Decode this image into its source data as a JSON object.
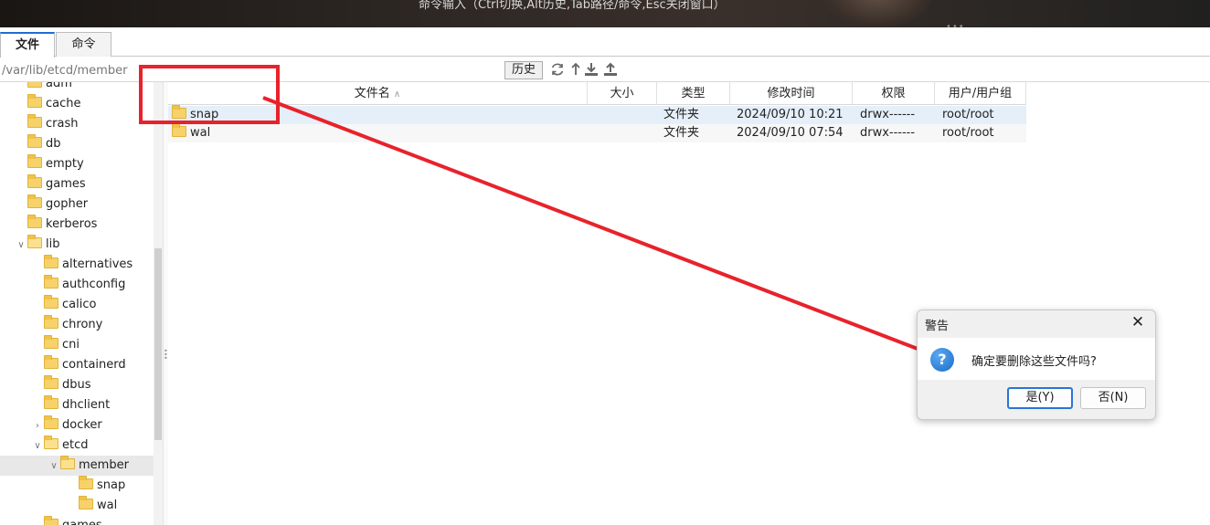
{
  "topbar": {
    "hint": "命令输入（Ctrl切换,Alt历史,Tab路径/命令,Esc关闭窗口）"
  },
  "tabs": [
    {
      "label": "文件"
    },
    {
      "label": "命令"
    }
  ],
  "pathbar": {
    "path": "/var/lib/etcd/member",
    "history_label": "历史"
  },
  "tree": {
    "items": [
      {
        "label": "adm"
      },
      {
        "label": "cache"
      },
      {
        "label": "crash"
      },
      {
        "label": "db"
      },
      {
        "label": "empty"
      },
      {
        "label": "games"
      },
      {
        "label": "gopher"
      },
      {
        "label": "kerberos"
      },
      {
        "label": "lib"
      },
      {
        "label": "alternatives"
      },
      {
        "label": "authconfig"
      },
      {
        "label": "calico"
      },
      {
        "label": "chrony"
      },
      {
        "label": "cni"
      },
      {
        "label": "containerd"
      },
      {
        "label": "dbus"
      },
      {
        "label": "dhclient"
      },
      {
        "label": "docker"
      },
      {
        "label": "etcd"
      },
      {
        "label": "member"
      },
      {
        "label": "snap"
      },
      {
        "label": "wal"
      },
      {
        "label": "games"
      }
    ]
  },
  "table": {
    "headers": [
      "文件名",
      "大小",
      "类型",
      "修改时间",
      "权限",
      "用户/用户组"
    ],
    "sort_glyph": "∧",
    "rows": [
      {
        "name": "snap",
        "size": "",
        "type": "文件夹",
        "modified": "2024/09/10 10:21",
        "perm": "drwx------",
        "owner": "root/root"
      },
      {
        "name": "wal",
        "size": "",
        "type": "文件夹",
        "modified": "2024/09/10 07:54",
        "perm": "drwx------",
        "owner": "root/root"
      }
    ]
  },
  "dialog": {
    "title": "警告",
    "message": "确定要删除这些文件吗?",
    "yes_label": "是(Y)",
    "no_label": "否(N)"
  },
  "colors": {
    "annotation": "#e8222b",
    "accent": "#2a74d6",
    "selection": "#e5eff9"
  }
}
